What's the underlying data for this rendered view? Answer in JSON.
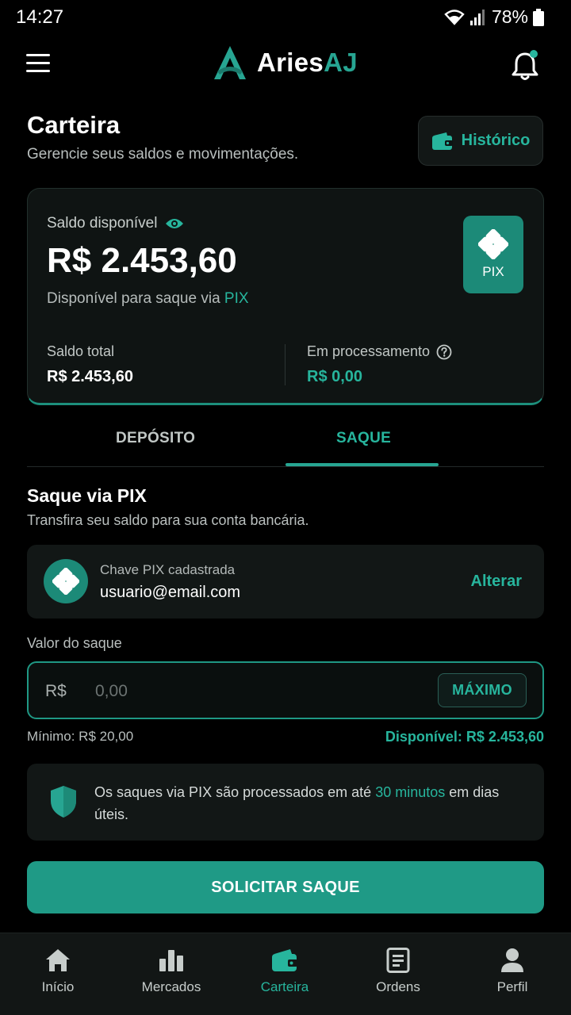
{
  "status_bar": {
    "time": "14:27",
    "battery": "78%"
  },
  "header": {
    "brand_part1": "Aries",
    "brand_part2": "AJ"
  },
  "page": {
    "title": "Carteira",
    "subtitle": "Gerencie seus saldos e movimentações.",
    "history_button": "Histórico"
  },
  "balance": {
    "available_label": "Saldo disponível",
    "available_amount": "R$ 2.453,60",
    "note_prefix": "Disponível para saque via ",
    "note_pix": "PIX",
    "badge_label": "PIX",
    "total_label": "Saldo total",
    "total_value": "R$ 2.453,60",
    "processing_label": "Em processamento",
    "processing_value": "R$ 0,00"
  },
  "tabs": [
    {
      "label": "DEPÓSITO",
      "active": false
    },
    {
      "label": "SAQUE",
      "active": true
    }
  ],
  "withdraw": {
    "title": "Saque via PIX",
    "subtitle": "Transfira seu saldo para sua conta bancária.",
    "pix_key_label": "Chave PIX cadastrada",
    "pix_key_value": "usuario@email.com",
    "change_link": "Alterar",
    "amount_label": "Valor do saque",
    "currency_prefix": "R$",
    "amount_placeholder": "0,00",
    "max_button": "MÁXIMO",
    "minimum_text": "Mínimo: R$ 20,00",
    "available_text": "Disponível: R$ 2.453,60",
    "info_prefix": "Os saques via PIX são processados em até ",
    "info_highlight": "30 minutos",
    "info_suffix": " em dias úteis.",
    "submit_button": "SOLICITAR SAQUE"
  },
  "bottom_nav": [
    {
      "label": "Início",
      "icon": "home-icon",
      "active": false
    },
    {
      "label": "Mercados",
      "icon": "bar-chart-icon",
      "active": false
    },
    {
      "label": "Carteira",
      "icon": "wallet-icon",
      "active": true
    },
    {
      "label": "Ordens",
      "icon": "orders-icon",
      "active": false
    },
    {
      "label": "Perfil",
      "icon": "person-icon",
      "active": false
    }
  ],
  "colors": {
    "accent": "#27b59d",
    "button": "#1f9a86",
    "background": "#000000",
    "card": "#121716"
  }
}
